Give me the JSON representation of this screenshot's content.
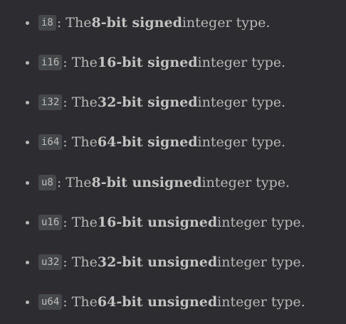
{
  "items": [
    {
      "code": "i8",
      "prefix": ": The ",
      "bold": "8-bit signed",
      "suffix": " integer type."
    },
    {
      "code": "i16",
      "prefix": ": The ",
      "bold": "16-bit signed",
      "suffix": " integer type."
    },
    {
      "code": "i32",
      "prefix": ": The ",
      "bold": "32-bit signed",
      "suffix": " integer type."
    },
    {
      "code": "i64",
      "prefix": ": The ",
      "bold": "64-bit signed",
      "suffix": " integer type."
    },
    {
      "code": "u8",
      "prefix": ": The ",
      "bold": "8-bit unsigned",
      "suffix": " integer type."
    },
    {
      "code": "u16",
      "prefix": ": The ",
      "bold": "16-bit unsigned",
      "suffix": " integer type."
    },
    {
      "code": "u32",
      "prefix": ": The ",
      "bold": "32-bit unsigned",
      "suffix": " integer type."
    },
    {
      "code": "u64",
      "prefix": ": The ",
      "bold": "64-bit unsigned",
      "suffix": " integer type."
    }
  ]
}
